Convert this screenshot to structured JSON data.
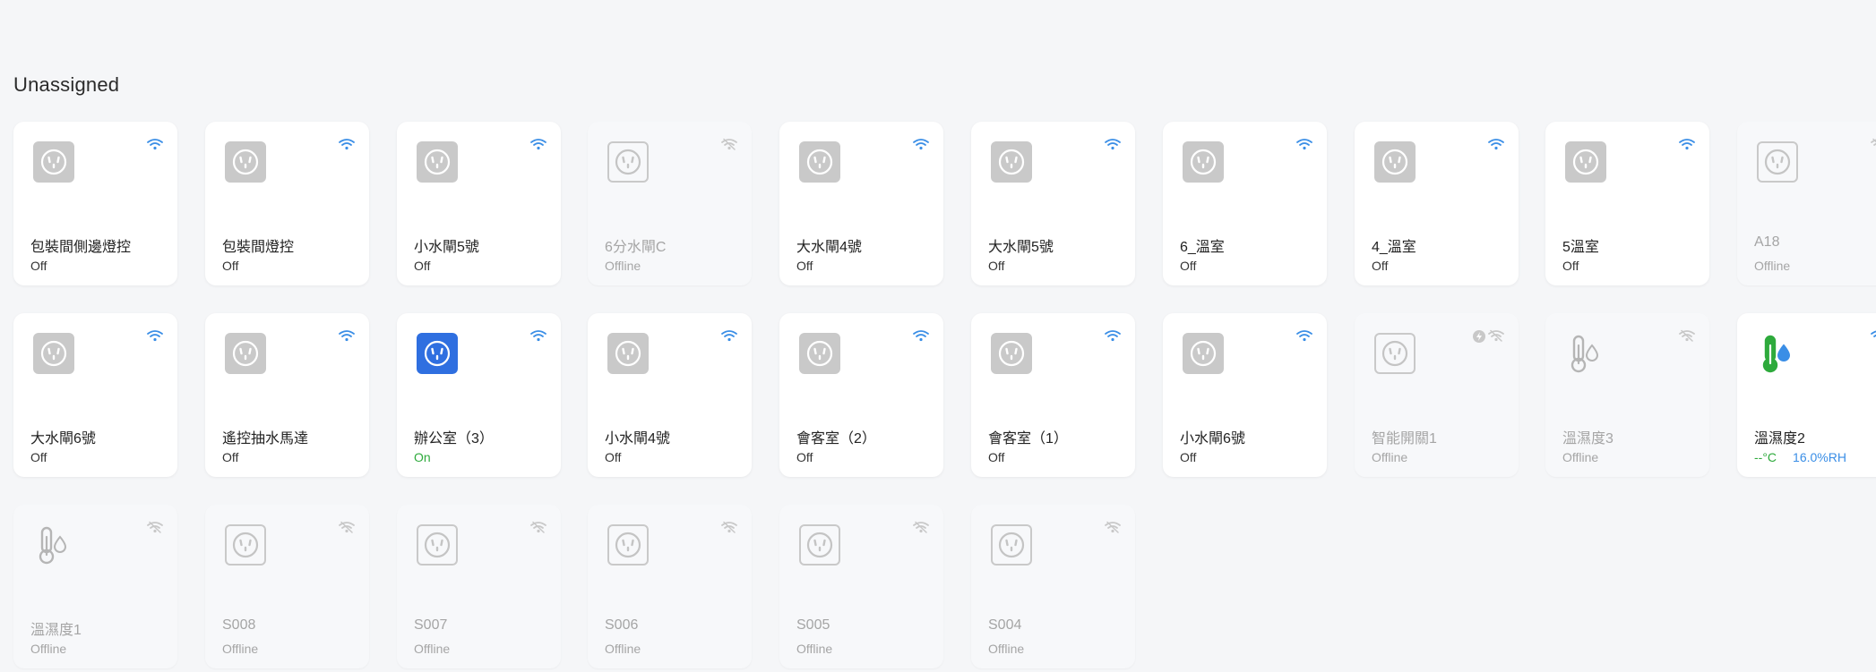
{
  "section": {
    "title": "Unassigned"
  },
  "colors": {
    "wifi_on": "#3a8ee6",
    "wifi_off": "#c8c8c8",
    "plug_on": "#2f6fe0",
    "plug_off": "#c9c9c9",
    "on_text": "#2eaa3c"
  },
  "devices": [
    {
      "name": "包裝間側邊燈控",
      "status": "Off",
      "icon": "plug-icon",
      "wifi": "on",
      "online": true
    },
    {
      "name": "包裝間燈控",
      "status": "Off",
      "icon": "plug-icon",
      "wifi": "on",
      "online": true
    },
    {
      "name": "小水閘5號",
      "status": "Off",
      "icon": "plug-icon",
      "wifi": "on",
      "online": true
    },
    {
      "name": "6分水閘C",
      "status": "Offline",
      "icon": "plug-icon",
      "wifi": "off",
      "online": false
    },
    {
      "name": "大水閘4號",
      "status": "Off",
      "icon": "plug-icon",
      "wifi": "on",
      "online": true
    },
    {
      "name": "大水閘5號",
      "status": "Off",
      "icon": "plug-icon",
      "wifi": "on",
      "online": true
    },
    {
      "name": "6_溫室",
      "status": "Off",
      "icon": "plug-icon",
      "wifi": "on",
      "online": true
    },
    {
      "name": "4_溫室",
      "status": "Off",
      "icon": "plug-icon",
      "wifi": "on",
      "online": true
    },
    {
      "name": "5溫室",
      "status": "Off",
      "icon": "plug-icon",
      "wifi": "on",
      "online": true
    },
    {
      "name": "A18",
      "status": "Offline",
      "icon": "plug-icon",
      "wifi": "off",
      "online": false
    },
    {
      "name": "大水閘6號",
      "status": "Off",
      "icon": "plug-icon",
      "wifi": "on",
      "online": true
    },
    {
      "name": "遙控抽水馬達",
      "status": "Off",
      "icon": "plug-icon",
      "wifi": "on",
      "online": true
    },
    {
      "name": "辦公室（3）",
      "status": "On",
      "icon": "plug-icon",
      "wifi": "on",
      "online": true,
      "active": true
    },
    {
      "name": "小水閘4號",
      "status": "Off",
      "icon": "plug-icon",
      "wifi": "on",
      "online": true
    },
    {
      "name": "會客室（2）",
      "status": "Off",
      "icon": "plug-icon",
      "wifi": "on",
      "online": true
    },
    {
      "name": "會客室（1）",
      "status": "Off",
      "icon": "plug-icon",
      "wifi": "on",
      "online": true
    },
    {
      "name": "小水閘6號",
      "status": "Off",
      "icon": "plug-icon",
      "wifi": "on",
      "online": true
    },
    {
      "name": "智能開關1",
      "status": "Offline",
      "icon": "plug-icon",
      "wifi": "off",
      "online": false,
      "extra_icon": "power-plug-icon"
    },
    {
      "name": "溫濕度3",
      "status": "Offline",
      "icon": "thermo-humidity-icon",
      "wifi": "off",
      "online": false
    },
    {
      "name": "溫濕度2",
      "status": "",
      "icon": "thermo-humidity-icon",
      "wifi": "on",
      "online": true,
      "temp": "--°C",
      "humidity": "16.0%RH"
    },
    {
      "name": "溫濕度1",
      "status": "Offline",
      "icon": "thermo-humidity-icon",
      "wifi": "off",
      "online": false
    },
    {
      "name": "S008",
      "status": "Offline",
      "icon": "plug-icon",
      "wifi": "off",
      "online": false
    },
    {
      "name": "S007",
      "status": "Offline",
      "icon": "plug-icon",
      "wifi": "off",
      "online": false
    },
    {
      "name": "S006",
      "status": "Offline",
      "icon": "plug-icon",
      "wifi": "off",
      "online": false
    },
    {
      "name": "S005",
      "status": "Offline",
      "icon": "plug-icon",
      "wifi": "off",
      "online": false
    },
    {
      "name": "S004",
      "status": "Offline",
      "icon": "plug-icon",
      "wifi": "off",
      "online": false
    }
  ]
}
